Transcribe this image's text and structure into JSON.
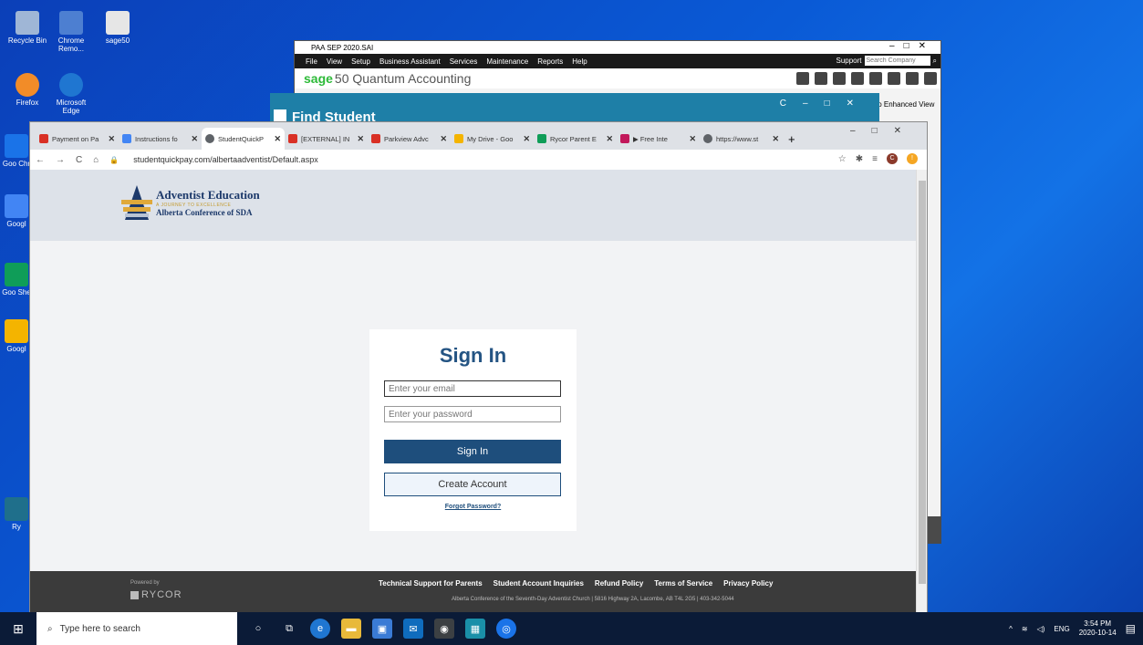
{
  "desktop": {
    "icons": [
      {
        "label": "Recycle Bin"
      },
      {
        "label": "Chrome Remo..."
      },
      {
        "label": "sage50"
      },
      {
        "label": "Firefox"
      },
      {
        "label": "Microsoft Edge"
      },
      {
        "label": "Goo Chr"
      },
      {
        "label": "Googl"
      },
      {
        "label": "Goo She"
      },
      {
        "label": "Googl"
      },
      {
        "label": "Ry"
      }
    ]
  },
  "sage": {
    "title": "PAA SEP 2020.SAI",
    "menu": [
      "File",
      "View",
      "Setup",
      "Business Assistant",
      "Services",
      "Maintenance",
      "Reports",
      "Help"
    ],
    "support": "Support",
    "search_placeholder": "Search Company",
    "brand_bold": "sage",
    "brand_rest": "50 Quantum Accounting",
    "enhanced": "to Enhanced View"
  },
  "find_student": {
    "title": "Find Student"
  },
  "browser": {
    "tabs": [
      {
        "label": "Payment on Pa",
        "color": "#d93025"
      },
      {
        "label": "Instructions fo",
        "color": "#4285f4"
      },
      {
        "label": "StudentQuickP",
        "color": "#5f6368"
      },
      {
        "label": "[EXTERNAL] IN",
        "color": "#d93025"
      },
      {
        "label": "Parkview Advc",
        "color": "#d93025"
      },
      {
        "label": "My Drive - Goo",
        "color": "#f4b400"
      },
      {
        "label": "Rycor Parent E",
        "color": "#0f9d58"
      },
      {
        "label": "▶ Free Inte",
        "color": "#c2185b"
      },
      {
        "label": "https://www.st",
        "color": "#5f6368"
      }
    ],
    "url": "studentquickpay.com/albertaadventist/Default.aspx"
  },
  "site": {
    "logo": {
      "line1": "Adventist Education",
      "line2": "A JOURNEY TO EXCELLENCE",
      "line3": "Alberta Conference of SDA"
    },
    "signin": {
      "title": "Sign In",
      "email_placeholder": "Enter your email",
      "password_placeholder": "Enter your password",
      "signin_button": "Sign In",
      "create_button": "Create Account",
      "forgot": "Forgot Password?"
    },
    "footer": {
      "powered": "Powered by",
      "rycor": "RYCOR",
      "links": [
        "Technical Support for Parents",
        "Student Account Inquiries",
        "Refund Policy",
        "Terms of Service",
        "Privacy Policy"
      ],
      "address": "Alberta Conference of the Seventh-Day Adventist Church | 5816 Highway 2A, Lacombe, AB T4L 2G5 | 403-342-5044"
    }
  },
  "taskbar": {
    "search_placeholder": "Type here to search",
    "lang": "ENG",
    "time": "3:54 PM",
    "date": "2020-10-14"
  },
  "colors": {
    "primary": "#1e4e7c",
    "title": "#245483",
    "sage_green": "#2dba38",
    "find_student_bar": "#1e7fa7"
  }
}
